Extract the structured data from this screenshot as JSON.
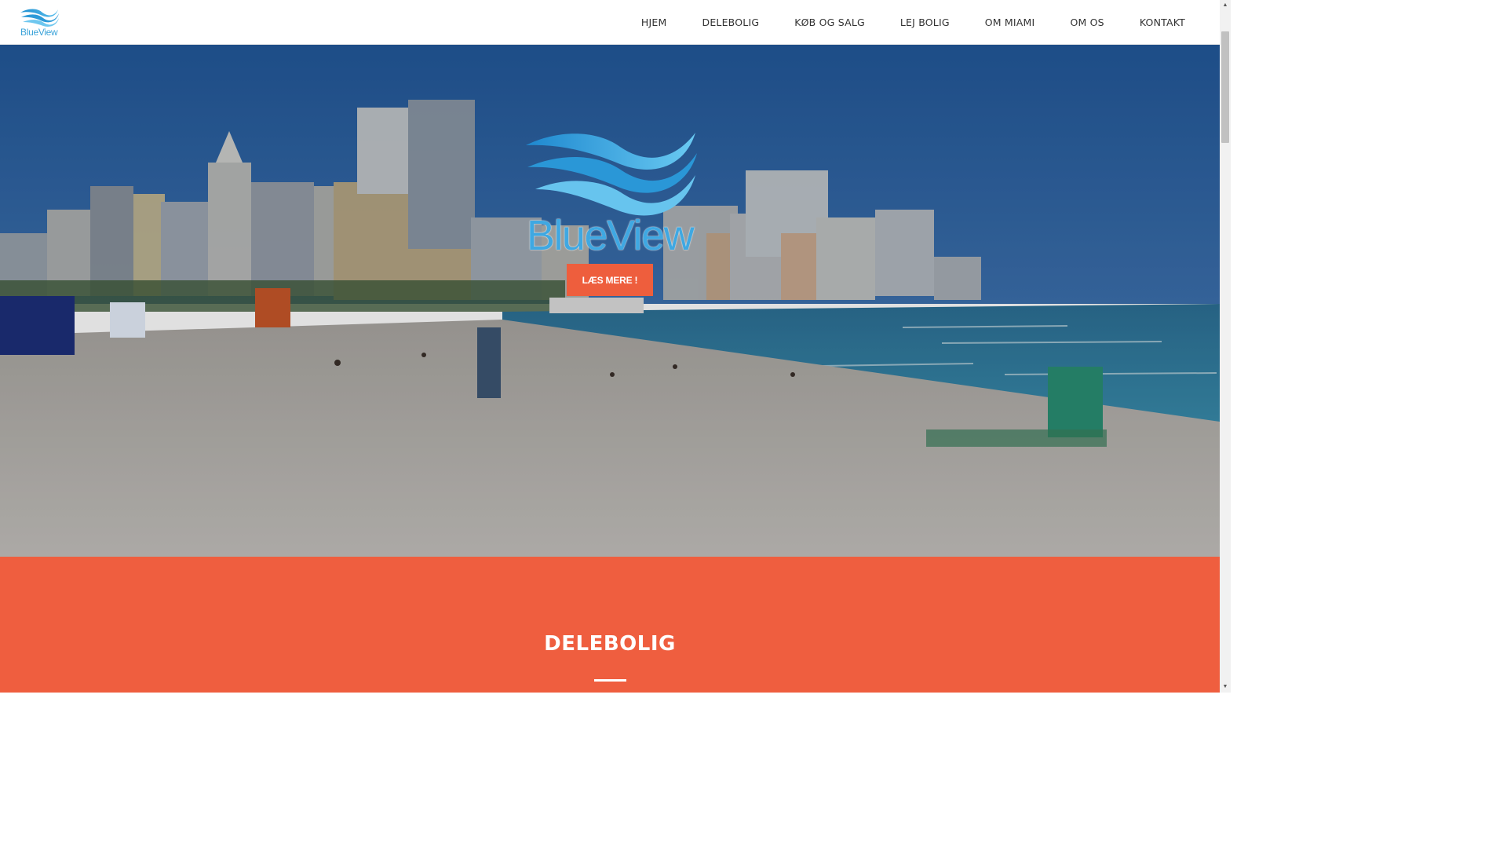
{
  "brand": {
    "name": "BlueView"
  },
  "nav": {
    "items": [
      {
        "label": "HJEM"
      },
      {
        "label": "DELEBOLIG"
      },
      {
        "label": "KØB OG SALG"
      },
      {
        "label": "LEJ BOLIG"
      },
      {
        "label": "OM MIAMI"
      },
      {
        "label": "OM OS"
      },
      {
        "label": "KONTAKT"
      }
    ]
  },
  "hero": {
    "brand_text": "BlueView",
    "cta_label": "LÆS MERE !"
  },
  "section": {
    "title": "DELEBOLIG"
  },
  "colors": {
    "accent": "#ef5e3f",
    "brand_blue": "#3fa8e2",
    "nav_text": "#333333"
  },
  "icons": {
    "logo": "blueview-wave-logo",
    "scroll_up": "scroll-up-arrow",
    "scroll_down": "scroll-down-arrow"
  }
}
